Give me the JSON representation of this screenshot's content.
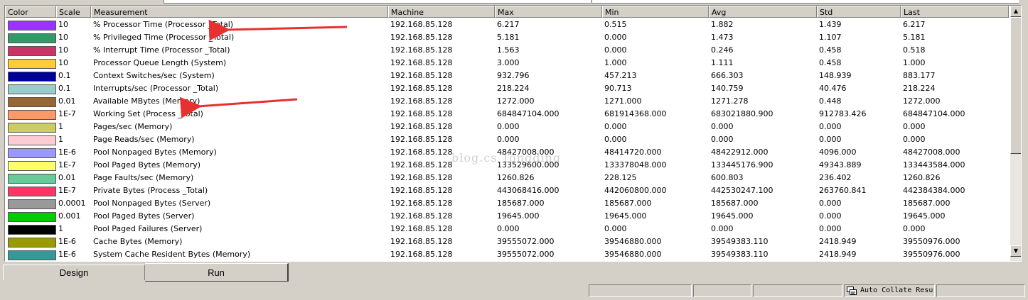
{
  "columns": [
    "Color",
    "Scale",
    "Measurement",
    "Machine",
    "Max",
    "Min",
    "Avg",
    "Std",
    "Last"
  ],
  "rows": [
    {
      "color": "#9933ff",
      "scale": "10",
      "measurement": "% Processor Time (Processor _Total)",
      "machine": "192.168.85.128",
      "max": "6.217",
      "min": "0.515",
      "avg": "1.882",
      "std": "1.439",
      "last": "6.217"
    },
    {
      "color": "#339966",
      "scale": "10",
      "measurement": "% Privileged Time (Processor _Total)",
      "machine": "192.168.85.128",
      "max": "5.181",
      "min": "0.000",
      "avg": "1.473",
      "std": "1.107",
      "last": "5.181"
    },
    {
      "color": "#cc3366",
      "scale": "10",
      "measurement": "% Interrupt Time (Processor _Total)",
      "machine": "192.168.85.128",
      "max": "1.563",
      "min": "0.000",
      "avg": "0.246",
      "std": "0.458",
      "last": "0.518"
    },
    {
      "color": "#ffcc33",
      "scale": "10",
      "measurement": "Processor Queue Length (System)",
      "machine": "192.168.85.128",
      "max": "3.000",
      "min": "1.000",
      "avg": "1.111",
      "std": "0.458",
      "last": "1.000"
    },
    {
      "color": "#000099",
      "scale": "0.1",
      "measurement": "Context Switches/sec (System)",
      "machine": "192.168.85.128",
      "max": "932.796",
      "min": "457.213",
      "avg": "666.303",
      "std": "148.939",
      "last": "883.177"
    },
    {
      "color": "#99cccc",
      "scale": "0.1",
      "measurement": "Interrupts/sec (Processor _Total)",
      "machine": "192.168.85.128",
      "max": "218.224",
      "min": "90.713",
      "avg": "140.759",
      "std": "40.476",
      "last": "218.224"
    },
    {
      "color": "#996633",
      "scale": "0.01",
      "measurement": "Available MBytes (Memory)",
      "machine": "192.168.85.128",
      "max": "1272.000",
      "min": "1271.000",
      "avg": "1271.278",
      "std": "0.448",
      "last": "1272.000"
    },
    {
      "color": "#ff9966",
      "scale": "1E-7",
      "measurement": "Working Set (Process _Total)",
      "machine": "192.168.85.128",
      "max": "684847104.000",
      "min": "681914368.000",
      "avg": "683021880.900",
      "std": "912783.426",
      "last": "684847104.000"
    },
    {
      "color": "#cccc66",
      "scale": "1",
      "measurement": "Pages/sec (Memory)",
      "machine": "192.168.85.128",
      "max": "0.000",
      "min": "0.000",
      "avg": "0.000",
      "std": "0.000",
      "last": "0.000"
    },
    {
      "color": "#ffccd5",
      "scale": "1",
      "measurement": "Page Reads/sec (Memory)",
      "machine": "192.168.85.128",
      "max": "0.000",
      "min": "0.000",
      "avg": "0.000",
      "std": "0.000",
      "last": "0.000"
    },
    {
      "color": "#9999ff",
      "scale": "1E-6",
      "measurement": "Pool Nonpaged Bytes (Memory)",
      "machine": "192.168.85.128",
      "max": "48427008.000",
      "min": "48414720.000",
      "avg": "48422912.000",
      "std": "4096.000",
      "last": "48427008.000"
    },
    {
      "color": "#ffff66",
      "scale": "1E-7",
      "measurement": "Pool Paged Bytes (Memory)",
      "machine": "192.168.85.128",
      "max": "133529600.000",
      "min": "133378048.000",
      "avg": "133445176.900",
      "std": "49343.889",
      "last": "133443584.000"
    },
    {
      "color": "#66cc99",
      "scale": "0.01",
      "measurement": "Page Faults/sec (Memory)",
      "machine": "192.168.85.128",
      "max": "1260.826",
      "min": "228.125",
      "avg": "600.803",
      "std": "236.402",
      "last": "1260.826"
    },
    {
      "color": "#ff3366",
      "scale": "1E-7",
      "measurement": "Private Bytes (Process _Total)",
      "machine": "192.168.85.128",
      "max": "443068416.000",
      "min": "442060800.000",
      "avg": "442530247.100",
      "std": "263760.841",
      "last": "442384384.000"
    },
    {
      "color": "#999999",
      "scale": "0.0001",
      "measurement": "Pool Nonpaged Bytes (Server)",
      "machine": "192.168.85.128",
      "max": "185687.000",
      "min": "185687.000",
      "avg": "185687.000",
      "std": "0.000",
      "last": "185687.000"
    },
    {
      "color": "#00cc00",
      "scale": "0.001",
      "measurement": "Pool Paged Bytes (Server)",
      "machine": "192.168.85.128",
      "max": "19645.000",
      "min": "19645.000",
      "avg": "19645.000",
      "std": "0.000",
      "last": "19645.000"
    },
    {
      "color": "#000000",
      "scale": "1",
      "measurement": "Pool Paged Failures (Server)",
      "machine": "192.168.85.128",
      "max": "0.000",
      "min": "0.000",
      "avg": "0.000",
      "std": "0.000",
      "last": "0.000"
    },
    {
      "color": "#999900",
      "scale": "1E-6",
      "measurement": "Cache Bytes (Memory)",
      "machine": "192.168.85.128",
      "max": "39555072.000",
      "min": "39546880.000",
      "avg": "39549383.110",
      "std": "2418.949",
      "last": "39550976.000"
    },
    {
      "color": "#339999",
      "scale": "1E-6",
      "measurement": "System Cache Resident Bytes (Memory)",
      "machine": "192.168.85.128",
      "max": "39555072.000",
      "min": "39546880.000",
      "avg": "39549383.110",
      "std": "2418.949",
      "last": "39550976.000"
    }
  ],
  "tabs": {
    "design": "Design",
    "run": "Run"
  },
  "status": {
    "auto_collate": "Auto Collate Resu"
  },
  "watermark": "blog.cs      Tongding",
  "scrollbar_icons": {
    "up": "scroll-up-arrow",
    "down": "scroll-down-arrow"
  },
  "annotation_color": "#e83030"
}
